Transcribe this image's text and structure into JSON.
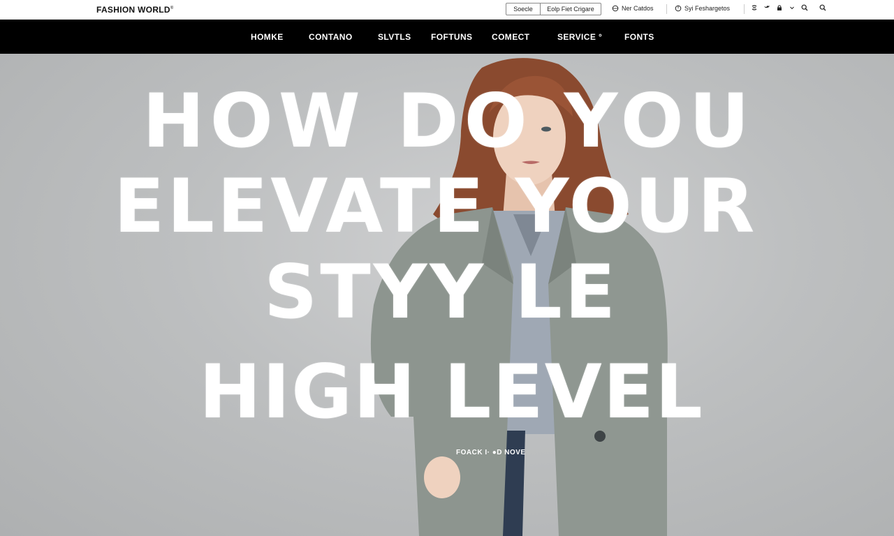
{
  "topbar": {
    "logo": "FASHION WORLD",
    "logo_mark": "®",
    "search_segment_1": "Soecle",
    "search_segment_2": "Eolp Fiet Crigare",
    "util_1": "Ner Catdos",
    "util_2": "Syi Feshargetos"
  },
  "nav": {
    "items": [
      "HOMKE",
      "CONTANO",
      "SLVTLS",
      "FOFTUNS",
      "COMECT",
      "SERVICE °",
      "FONTS"
    ]
  },
  "hero": {
    "headline_lines": [
      "HOW DO YOU",
      "ELEVATE YOUR",
      "STYY LE",
      "HIGH LEVEL"
    ],
    "cta": "FOACK I·  ●D NOVE"
  },
  "colors": {
    "nav_background": "#000000",
    "headline_text": "#ffffff",
    "hero_background": "#bdbfc0"
  },
  "icons": [
    "globe-icon",
    "globe-icon",
    "share-icon",
    "twitter-icon",
    "lock-icon",
    "chevron-down-icon",
    "search-icon",
    "search-icon"
  ]
}
